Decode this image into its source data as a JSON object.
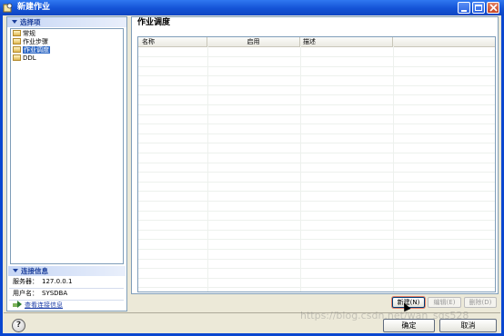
{
  "window": {
    "title": "新建作业",
    "icon": "new-job-icon",
    "controls": [
      "minimize-icon",
      "maximize-icon",
      "close-icon"
    ]
  },
  "left_panel": {
    "section_title": "选择项",
    "tree": [
      {
        "label": "常规",
        "selected": false
      },
      {
        "label": "作业步骤",
        "selected": false
      },
      {
        "label": "作业调度",
        "selected": true
      },
      {
        "label": "DDL",
        "selected": false
      }
    ],
    "connection": {
      "section_title": "连接信息",
      "server_label": "服务器：",
      "server_value": "127.0.0.1",
      "user_label": "用户名：",
      "user_value": "SYSDBA",
      "link_label": "查看连接信息"
    }
  },
  "main": {
    "page_title": "作业调度",
    "table": {
      "columns": [
        "名称",
        "启用",
        "描述"
      ],
      "rows": []
    },
    "buttons": {
      "new": "新建(N)",
      "edit": "编辑(E)",
      "delete": "删除(D)"
    }
  },
  "footer": {
    "ok": "确定",
    "cancel": "取消",
    "help_icon": "help-icon"
  },
  "watermark": "https://blog.csdn.net/wan_sqs528"
}
